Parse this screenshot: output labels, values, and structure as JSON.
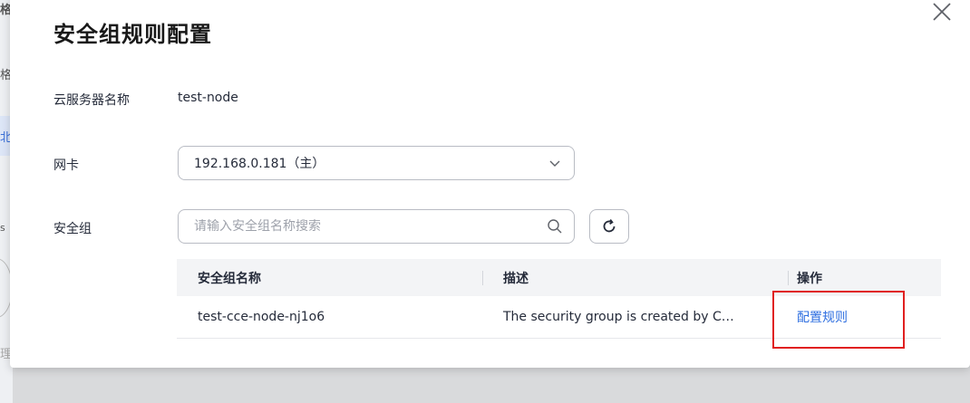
{
  "background": {
    "fragments": [
      "格",
      "北",
      "s",
      "理"
    ]
  },
  "dialog": {
    "title": "安全组规则配置",
    "close_icon": "close-icon",
    "server_name_label": "云服务器名称",
    "server_name_value": "test-node",
    "nic_label": "网卡",
    "nic_selected": "192.168.0.181（主）",
    "security_group_label": "安全组",
    "search_placeholder": "请输入安全组名称搜索",
    "search_icon": "search-icon",
    "refresh_icon": "refresh-icon",
    "table": {
      "headers": [
        "安全组名称",
        "描述",
        "操作"
      ],
      "rows": [
        {
          "name": "test-cce-node-nj1o6",
          "description": "The security group is created by C…",
          "action": "配置规则"
        }
      ]
    }
  },
  "colors": {
    "link": "#2f6fe0",
    "highlight": "#e02020"
  }
}
